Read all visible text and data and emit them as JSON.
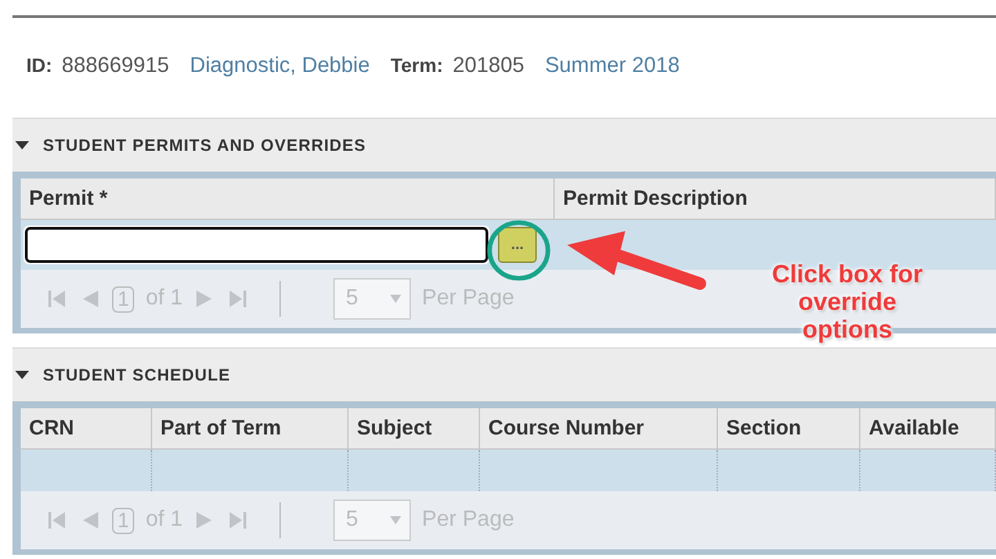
{
  "header": {
    "id_label": "ID:",
    "id_value": "888669915",
    "name": "Diagnostic, Debbie",
    "term_label": "Term:",
    "term_value": "201805",
    "term_name": "Summer 2018"
  },
  "sections": [
    {
      "title": "STUDENT PERMITS AND OVERRIDES",
      "expanded": true,
      "columns": [
        "Permit *",
        "Permit Description"
      ],
      "kind": "permit",
      "pager": {
        "page": "1",
        "of": "of 1",
        "per_page": "5",
        "per_page_label": "Per Page",
        "disabled": true
      }
    },
    {
      "title": "STUDENT SCHEDULE",
      "expanded": true,
      "columns": [
        "CRN",
        "Part of Term",
        "Subject",
        "Course Number",
        "Section",
        "Available"
      ],
      "kind": "schedule",
      "pager": {
        "page": "1",
        "of": "of 1",
        "per_page": "5",
        "per_page_label": "Per Page",
        "disabled": true
      }
    }
  ],
  "callout": {
    "text": "Click box for override options",
    "button_label": "..."
  }
}
